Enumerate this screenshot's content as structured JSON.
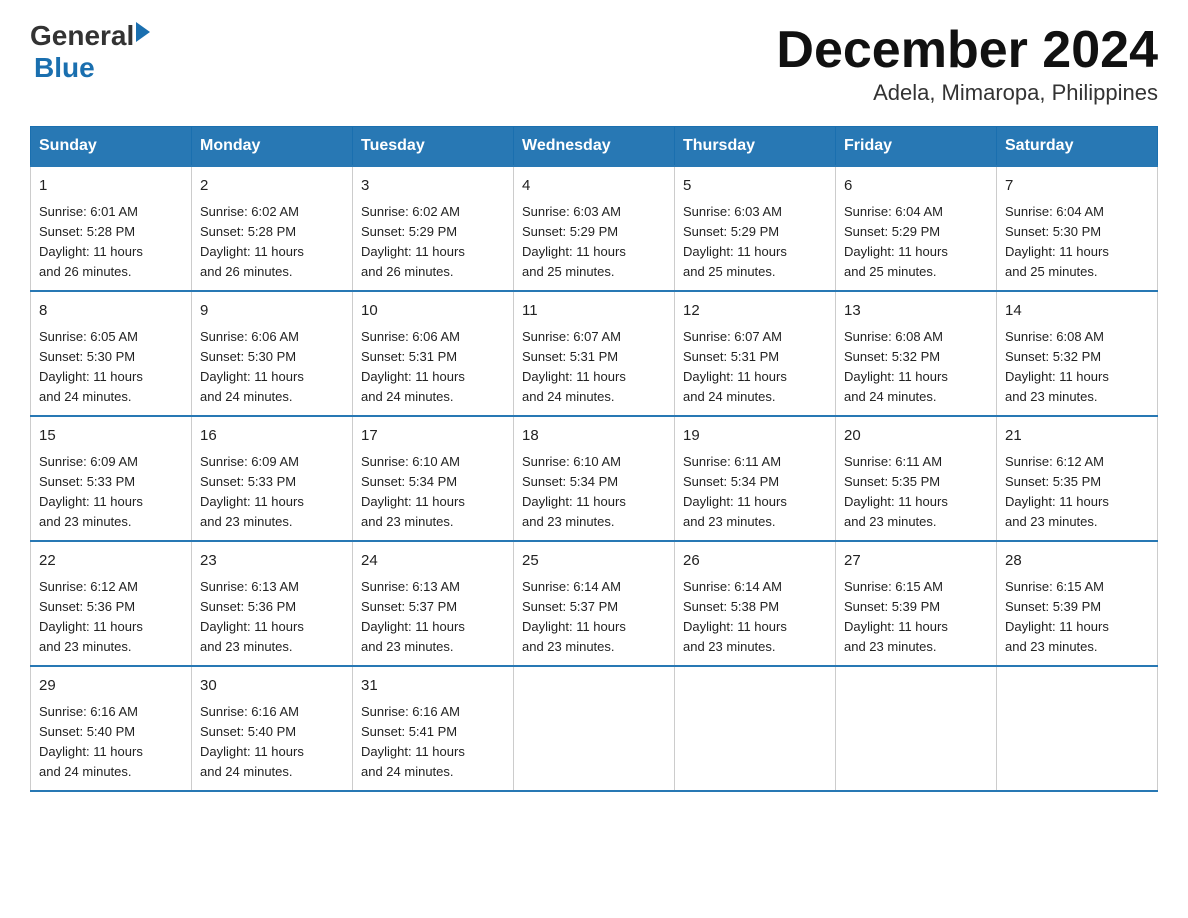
{
  "header": {
    "logo_general": "General",
    "logo_blue": "Blue",
    "month_title": "December 2024",
    "location": "Adela, Mimaropa, Philippines"
  },
  "days_of_week": [
    "Sunday",
    "Monday",
    "Tuesday",
    "Wednesday",
    "Thursday",
    "Friday",
    "Saturday"
  ],
  "weeks": [
    [
      {
        "day": "1",
        "sunrise": "6:01 AM",
        "sunset": "5:28 PM",
        "daylight": "11 hours and 26 minutes."
      },
      {
        "day": "2",
        "sunrise": "6:02 AM",
        "sunset": "5:28 PM",
        "daylight": "11 hours and 26 minutes."
      },
      {
        "day": "3",
        "sunrise": "6:02 AM",
        "sunset": "5:29 PM",
        "daylight": "11 hours and 26 minutes."
      },
      {
        "day": "4",
        "sunrise": "6:03 AM",
        "sunset": "5:29 PM",
        "daylight": "11 hours and 25 minutes."
      },
      {
        "day": "5",
        "sunrise": "6:03 AM",
        "sunset": "5:29 PM",
        "daylight": "11 hours and 25 minutes."
      },
      {
        "day": "6",
        "sunrise": "6:04 AM",
        "sunset": "5:29 PM",
        "daylight": "11 hours and 25 minutes."
      },
      {
        "day": "7",
        "sunrise": "6:04 AM",
        "sunset": "5:30 PM",
        "daylight": "11 hours and 25 minutes."
      }
    ],
    [
      {
        "day": "8",
        "sunrise": "6:05 AM",
        "sunset": "5:30 PM",
        "daylight": "11 hours and 24 minutes."
      },
      {
        "day": "9",
        "sunrise": "6:06 AM",
        "sunset": "5:30 PM",
        "daylight": "11 hours and 24 minutes."
      },
      {
        "day": "10",
        "sunrise": "6:06 AM",
        "sunset": "5:31 PM",
        "daylight": "11 hours and 24 minutes."
      },
      {
        "day": "11",
        "sunrise": "6:07 AM",
        "sunset": "5:31 PM",
        "daylight": "11 hours and 24 minutes."
      },
      {
        "day": "12",
        "sunrise": "6:07 AM",
        "sunset": "5:31 PM",
        "daylight": "11 hours and 24 minutes."
      },
      {
        "day": "13",
        "sunrise": "6:08 AM",
        "sunset": "5:32 PM",
        "daylight": "11 hours and 24 minutes."
      },
      {
        "day": "14",
        "sunrise": "6:08 AM",
        "sunset": "5:32 PM",
        "daylight": "11 hours and 23 minutes."
      }
    ],
    [
      {
        "day": "15",
        "sunrise": "6:09 AM",
        "sunset": "5:33 PM",
        "daylight": "11 hours and 23 minutes."
      },
      {
        "day": "16",
        "sunrise": "6:09 AM",
        "sunset": "5:33 PM",
        "daylight": "11 hours and 23 minutes."
      },
      {
        "day": "17",
        "sunrise": "6:10 AM",
        "sunset": "5:34 PM",
        "daylight": "11 hours and 23 minutes."
      },
      {
        "day": "18",
        "sunrise": "6:10 AM",
        "sunset": "5:34 PM",
        "daylight": "11 hours and 23 minutes."
      },
      {
        "day": "19",
        "sunrise": "6:11 AM",
        "sunset": "5:34 PM",
        "daylight": "11 hours and 23 minutes."
      },
      {
        "day": "20",
        "sunrise": "6:11 AM",
        "sunset": "5:35 PM",
        "daylight": "11 hours and 23 minutes."
      },
      {
        "day": "21",
        "sunrise": "6:12 AM",
        "sunset": "5:35 PM",
        "daylight": "11 hours and 23 minutes."
      }
    ],
    [
      {
        "day": "22",
        "sunrise": "6:12 AM",
        "sunset": "5:36 PM",
        "daylight": "11 hours and 23 minutes."
      },
      {
        "day": "23",
        "sunrise": "6:13 AM",
        "sunset": "5:36 PM",
        "daylight": "11 hours and 23 minutes."
      },
      {
        "day": "24",
        "sunrise": "6:13 AM",
        "sunset": "5:37 PM",
        "daylight": "11 hours and 23 minutes."
      },
      {
        "day": "25",
        "sunrise": "6:14 AM",
        "sunset": "5:37 PM",
        "daylight": "11 hours and 23 minutes."
      },
      {
        "day": "26",
        "sunrise": "6:14 AM",
        "sunset": "5:38 PM",
        "daylight": "11 hours and 23 minutes."
      },
      {
        "day": "27",
        "sunrise": "6:15 AM",
        "sunset": "5:39 PM",
        "daylight": "11 hours and 23 minutes."
      },
      {
        "day": "28",
        "sunrise": "6:15 AM",
        "sunset": "5:39 PM",
        "daylight": "11 hours and 23 minutes."
      }
    ],
    [
      {
        "day": "29",
        "sunrise": "6:16 AM",
        "sunset": "5:40 PM",
        "daylight": "11 hours and 24 minutes."
      },
      {
        "day": "30",
        "sunrise": "6:16 AM",
        "sunset": "5:40 PM",
        "daylight": "11 hours and 24 minutes."
      },
      {
        "day": "31",
        "sunrise": "6:16 AM",
        "sunset": "5:41 PM",
        "daylight": "11 hours and 24 minutes."
      },
      null,
      null,
      null,
      null
    ]
  ],
  "labels": {
    "sunrise": "Sunrise:",
    "sunset": "Sunset:",
    "daylight": "Daylight:"
  }
}
